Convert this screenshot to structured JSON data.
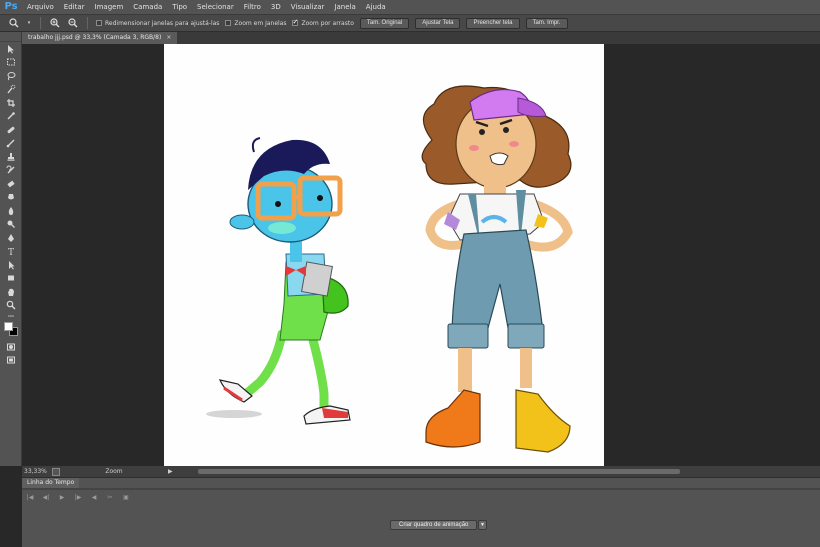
{
  "app": {
    "logo": "Ps",
    "menu": [
      "Arquivo",
      "Editar",
      "Imagem",
      "Camada",
      "Tipo",
      "Selecionar",
      "Filtro",
      "3D",
      "Visualizar",
      "Janela",
      "Ajuda"
    ]
  },
  "options_bar": {
    "icons": [
      "zoom-icon",
      "zoom-in-icon",
      "zoom-out-icon"
    ],
    "checkboxes": [
      {
        "label": "Redimensionar janelas para ajustá-las",
        "checked": false
      },
      {
        "label": "Zoom em Janelas",
        "checked": false
      },
      {
        "label": "Zoom por arrasto",
        "checked": true
      }
    ],
    "buttons": [
      "Tam. Original",
      "Ajustar Tela",
      "Preencher tela",
      "Tam. Impr."
    ]
  },
  "document": {
    "tab_title": "trabalho jjj.psd @ 33,3% (Camada 3, RGB/8)",
    "close": "×"
  },
  "tools": [
    "move-tool-icon",
    "marquee-tool-icon",
    "lasso-tool-icon",
    "quick-select-tool-icon",
    "crop-tool-icon",
    "eyedropper-tool-icon",
    "healing-brush-tool-icon",
    "brush-tool-icon",
    "clone-stamp-tool-icon",
    "history-brush-tool-icon",
    "eraser-tool-icon",
    "gradient-tool-icon",
    "blur-tool-icon",
    "dodge-tool-icon",
    "pen-tool-icon",
    "type-tool-icon",
    "path-select-tool-icon",
    "shape-tool-icon",
    "hand-tool-icon",
    "zoom-tool-icon"
  ],
  "colors": {
    "foreground": "#ffffff",
    "background": "#000000",
    "accent": "#4aa8f0"
  },
  "status": {
    "zoom": "33,33%",
    "mode": "Zoom",
    "arrow": "▶"
  },
  "timeline": {
    "tab": "Linha do Tempo",
    "controls": [
      "|◀",
      "◀|",
      "▶",
      "|▶",
      "◀",
      "✂",
      "▣"
    ],
    "create_button": "Criar quadro de animação",
    "dropdown": "▼"
  }
}
